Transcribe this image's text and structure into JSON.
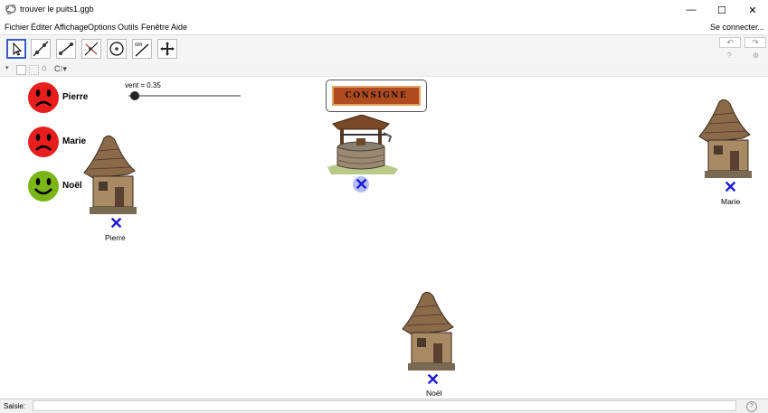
{
  "window": {
    "title": "trouver le puits1.ggb",
    "minimize": "—",
    "maximize": "☐",
    "close": "✕"
  },
  "menu": {
    "items": [
      "Fichier",
      "Éditer",
      "Affichage",
      "Options",
      "Outils",
      "Fenêtre",
      "Aide"
    ],
    "connect": "Se connecter..."
  },
  "toolbar": {
    "tools": [
      "move-tool",
      "line-tool",
      "segment-tool",
      "perpendicular-tool",
      "circle-tool",
      "slider-tool",
      "move-view-tool"
    ],
    "undo_icon": "undo-icon",
    "redo_icon": "redo-icon",
    "help_icon": "help-icon",
    "settings_icon": "gear-icon",
    "slider_tool_caption": "om"
  },
  "stylebar": {
    "caption": "C"
  },
  "people": [
    {
      "name": "Pierre",
      "mood": "sad",
      "color": "#e81e1e"
    },
    {
      "name": "Marie",
      "mood": "sad",
      "color": "#e81e1e"
    },
    {
      "name": "Noël",
      "mood": "happy",
      "color": "#7cb518"
    }
  ],
  "slider": {
    "label": "vent = 0.35",
    "value": 0.35
  },
  "consigne": {
    "text": "CONSIGNE"
  },
  "houses": [
    {
      "label": "Pierre"
    },
    {
      "label": "Marie"
    },
    {
      "label": "Noël"
    }
  ],
  "point_marker": "✕",
  "colors": {
    "point": "#1a1ad6",
    "slider_knob": "#222222",
    "consigne_bg": "#b24a1f"
  },
  "input_bar": {
    "label": "Saisie:",
    "value": ""
  }
}
